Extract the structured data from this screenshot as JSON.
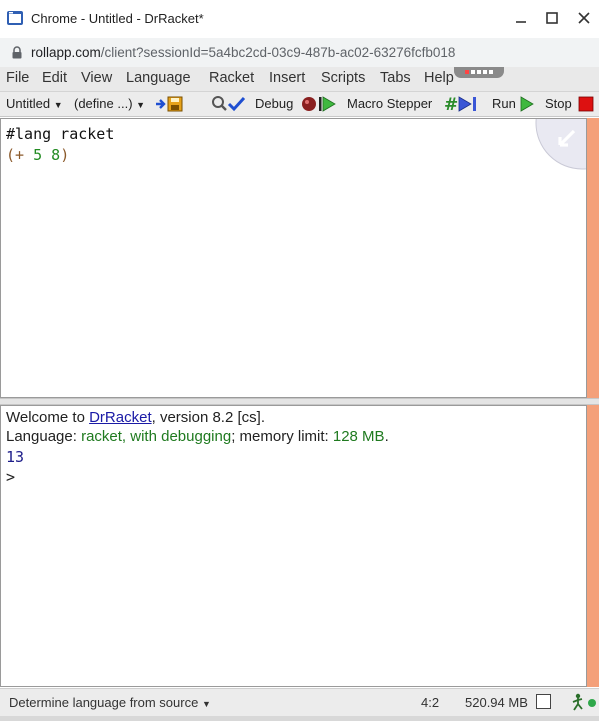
{
  "window": {
    "title": "Chrome - Untitled - DrRacket*",
    "icon": "drracket-app-icon"
  },
  "browser": {
    "url_host": "rollapp.com",
    "url_path": "/client?sessionId=5a4bc2cd-03c9-487b-ac02-63276fcfb018"
  },
  "menubar": {
    "items": [
      "File",
      "Edit",
      "View",
      "Language",
      "Racket",
      "Insert",
      "Scripts",
      "Tabs",
      "Help"
    ]
  },
  "toolbar": {
    "file_dropdown": "Untitled",
    "define_dropdown": "(define ...)",
    "debug_label": "Debug",
    "macro_stepper_label": "Macro Stepper",
    "run_label": "Run",
    "stop_label": "Stop"
  },
  "editor": {
    "line1": "#lang racket",
    "line2_open": "(+ ",
    "line2_num1": "5",
    "line2_space": " ",
    "line2_num2": "8",
    "line2_close": ")"
  },
  "repl": {
    "welcome_prefix": "Welcome to ",
    "welcome_link": "DrRacket",
    "welcome_suffix": ", version 8.2 [cs].",
    "lang_prefix": "Language: ",
    "lang_name": "racket, with debugging",
    "mem_prefix": "; memory limit: ",
    "mem_value": "128 MB",
    "mem_suffix": ".",
    "result": "13",
    "prompt": ">"
  },
  "statusbar": {
    "language_selector": "Determine language from source",
    "position": "4:2",
    "memory": "520.94 MB"
  },
  "colors": {
    "scrollbar_accent": "#f4a07a",
    "stop_red": "#dd1111",
    "run_green": "#33b833",
    "link_blue": "#1a1aa6",
    "lang_green": "#1f7a1f"
  }
}
